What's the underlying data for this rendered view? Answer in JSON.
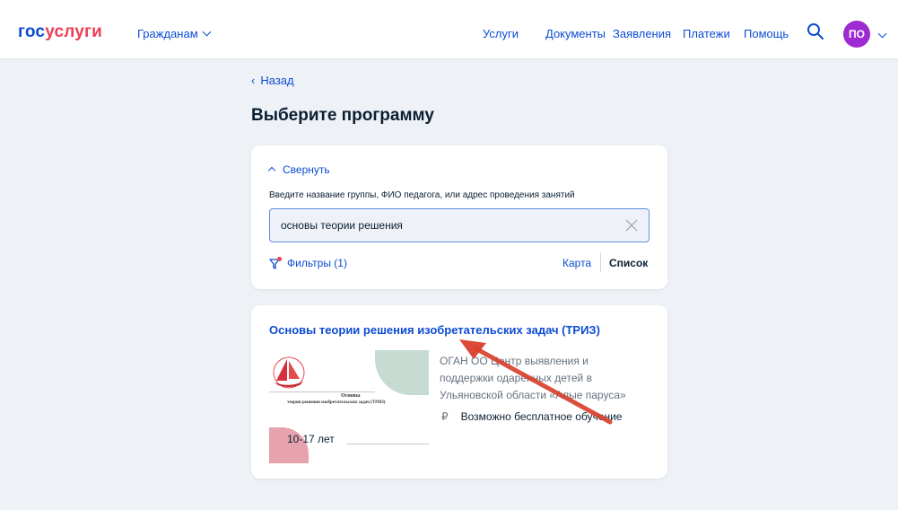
{
  "header": {
    "logo_part1": "гос",
    "logo_part2": "услуги",
    "citizens_menu": "Гражданам",
    "nav": [
      "Услуги",
      "Документы",
      "Заявления",
      "Платежи",
      "Помощь"
    ],
    "avatar_initials": "ПО",
    "brand_color": "#0d4cd3",
    "avatar_color": "#9e2bd1"
  },
  "page": {
    "back_label": "Назад",
    "title": "Выберите программу"
  },
  "search": {
    "collapse_label": "Свернуть",
    "hint": "Введите название группы, ФИО педагога, или адрес проведения занятий",
    "value": "основы теории решения",
    "filters_label": "Фильтры (1)",
    "map_label": "Карта",
    "list_label": "Список"
  },
  "result": {
    "title": "Основы теории решения изобретательских задач (ТРИЗ)",
    "thumb_title": "Основы",
    "thumb_subtitle": "теории решения изобретательских задач (ТРИЗ)",
    "thumb_age": "10-17 лет",
    "org": "ОГАН ОО Центр выявления и поддержки одарённых детей в Ульяновской области «Алые паруса»",
    "free_label": "Возможно бесплатное обучение",
    "free_icon": "ruble-icon"
  }
}
